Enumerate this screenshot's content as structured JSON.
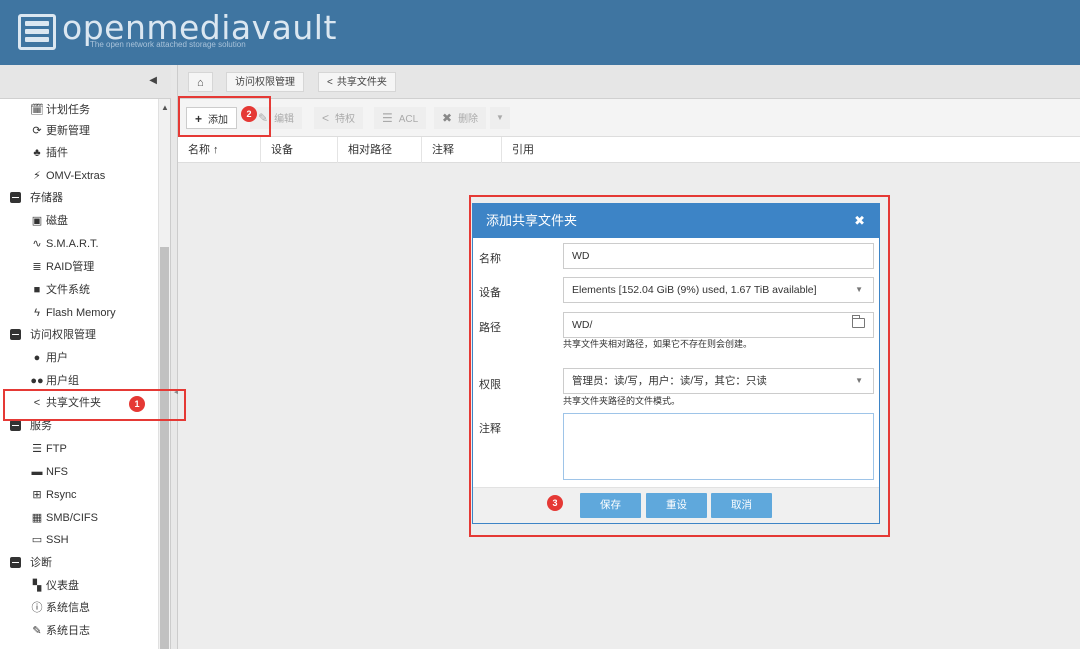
{
  "header": {
    "brand": "openmediavault",
    "tagline": "The open network attached storage solution"
  },
  "breadcrumb": {
    "home_icon": "home-icon",
    "items": [
      "访问权限管理",
      "共享文件夹"
    ]
  },
  "sidebar": {
    "items": [
      {
        "icon": "calendar-clock-icon",
        "label": "计划任务",
        "group": false
      },
      {
        "icon": "refresh-icon",
        "label": "更新管理",
        "group": false
      },
      {
        "icon": "puzzle-icon",
        "label": "插件",
        "group": false
      },
      {
        "icon": "plug-icon",
        "label": "OMV-Extras",
        "group": false
      },
      {
        "icon": "minus-box-icon",
        "label": "存储器",
        "group": true
      },
      {
        "icon": "disk-icon",
        "label": "磁盘",
        "group": false
      },
      {
        "icon": "heartbeat-icon",
        "label": "S.M.A.R.T.",
        "group": false
      },
      {
        "icon": "database-icon",
        "label": "RAID管理",
        "group": false
      },
      {
        "icon": "folder-icon",
        "label": "文件系统",
        "group": false
      },
      {
        "icon": "flash-icon",
        "label": "Flash Memory",
        "group": false
      },
      {
        "icon": "minus-box-icon",
        "label": "访问权限管理",
        "group": true
      },
      {
        "icon": "user-icon",
        "label": "用户",
        "group": false
      },
      {
        "icon": "users-icon",
        "label": "用户组",
        "group": false
      },
      {
        "icon": "share-icon",
        "label": "共享文件夹",
        "group": false
      },
      {
        "icon": "minus-box-icon",
        "label": "服务",
        "group": true
      },
      {
        "icon": "server-icon",
        "label": "FTP",
        "group": false
      },
      {
        "icon": "nfs-icon",
        "label": "NFS",
        "group": false
      },
      {
        "icon": "sitemap-icon",
        "label": "Rsync",
        "group": false
      },
      {
        "icon": "windows-icon",
        "label": "SMB/CIFS",
        "group": false
      },
      {
        "icon": "terminal-icon",
        "label": "SSH",
        "group": false
      },
      {
        "icon": "minus-box-icon",
        "label": "诊断",
        "group": true
      },
      {
        "icon": "dashboard-icon",
        "label": "仪表盘",
        "group": false
      },
      {
        "icon": "info-icon",
        "label": "系统信息",
        "group": false
      },
      {
        "icon": "edit-icon",
        "label": "系统日志",
        "group": false
      }
    ]
  },
  "toolbar": {
    "add": "添加",
    "edit": "编辑",
    "privileges": "特权",
    "acl": "ACL",
    "delete": "删除"
  },
  "grid": {
    "columns": [
      "名称 ↑",
      "设备",
      "相对路径",
      "注释",
      "引用"
    ]
  },
  "dialog": {
    "title": "添加共享文件夹",
    "name_label": "名称",
    "name_value": "WD",
    "device_label": "设备",
    "device_value": "Elements [152.04 GiB (9%) used, 1.67 TiB available]",
    "path_label": "路径",
    "path_value": "WD/",
    "path_hint": "共享文件夹相对路径，如果它不存在则会创建。",
    "perm_label": "权限",
    "perm_value": "管理员：读/写，用户：读/写，其它：只读",
    "perm_hint": "共享文件夹路径的文件模式。",
    "comment_label": "注释",
    "comment_value": "",
    "save": "保存",
    "reset": "重设",
    "cancel": "取消"
  },
  "annotations": {
    "badge1": "1",
    "badge2": "2",
    "badge3": "3",
    "color": "#e53935"
  },
  "colors": {
    "header": "#3f75a1",
    "dialog_title": "#3d84c6",
    "button": "#5fa8dc"
  }
}
